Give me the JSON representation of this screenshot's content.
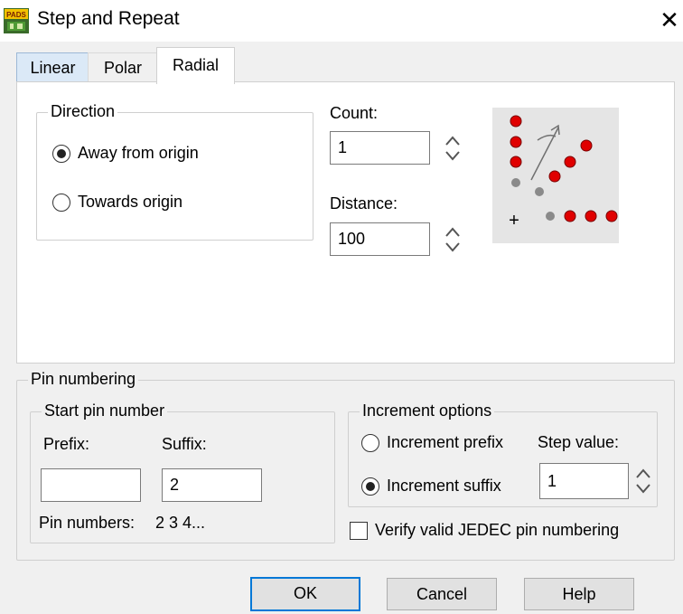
{
  "window": {
    "title": "Step and Repeat",
    "app_icon_text": "PADS",
    "close_glyph": "✕"
  },
  "tabs": {
    "linear": "Linear",
    "polar": "Polar",
    "radial": "Radial",
    "active": "Radial"
  },
  "direction": {
    "label": "Direction",
    "away": "Away from origin",
    "towards": "Towards origin",
    "selected": "Away from origin"
  },
  "count": {
    "label": "Count:",
    "value": "1"
  },
  "distance": {
    "label": "Distance:",
    "value": "100"
  },
  "preview": {
    "accent_red": "#e00000",
    "dot_grey": "#808080",
    "origin_glyph": "+"
  },
  "pin_numbering": {
    "label": "Pin numbering",
    "start": {
      "label": "Start pin number",
      "prefix_label": "Prefix:",
      "suffix_label": "Suffix:",
      "prefix_value": "",
      "suffix_value": "2"
    },
    "pin_numbers_label": "Pin numbers:",
    "pin_numbers_value": "2 3 4...",
    "increment": {
      "label": "Increment options",
      "prefix": "Increment prefix",
      "suffix": "Increment suffix",
      "selected": "Increment suffix",
      "step_label": "Step value:",
      "step_value": "1"
    },
    "verify_label": "Verify valid JEDEC pin numbering",
    "verify_checked": false
  },
  "buttons": {
    "ok": "OK",
    "cancel": "Cancel",
    "help": "Help"
  }
}
